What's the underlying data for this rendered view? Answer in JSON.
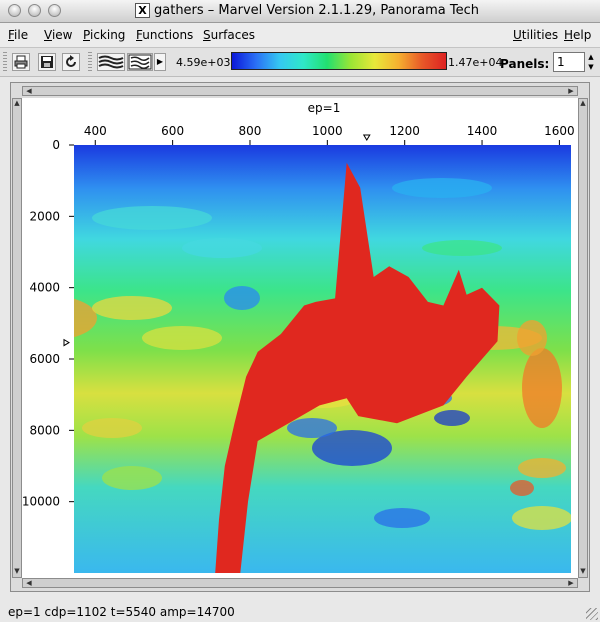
{
  "window": {
    "title": "gathers – Marvel Version 2.1.1.29, Panorama Tech",
    "x_glyph": "X"
  },
  "menu": {
    "file": "File",
    "view": "View",
    "picking": "Picking",
    "functions": "Functions",
    "surfaces": "Surfaces",
    "utilities": "Utilities",
    "help": "Help"
  },
  "toolbar": {
    "colorbar_min": "4.59e+03",
    "colorbar_max": "1.47e+04",
    "panels_label": "Panels:",
    "panels_value": "1",
    "colors": [
      "#0b18d9",
      "#2a6ff5",
      "#35c7f2",
      "#2fe8c8",
      "#22e070",
      "#9be535",
      "#e8e83a",
      "#f5b030",
      "#e85828",
      "#dd2222"
    ]
  },
  "plot": {
    "panel_title": "ep=1",
    "x_ticks": [
      "400",
      "600",
      "800",
      "1000",
      "1200",
      "1400",
      "1600"
    ],
    "y_ticks": [
      "0",
      "2000",
      "4000",
      "6000",
      "8000",
      "10000"
    ]
  },
  "chart_data": {
    "type": "heatmap",
    "title": "ep=1",
    "xlabel": "",
    "ylabel": "",
    "xlim": [
      345,
      1630
    ],
    "ylim": [
      0,
      12000
    ],
    "y_reversed": true,
    "x": [
      400,
      600,
      800,
      1000,
      1200,
      1400,
      1600
    ],
    "y": [
      0,
      2000,
      4000,
      6000,
      8000,
      10000
    ],
    "colorbar_range": [
      4590,
      14700
    ],
    "overlay_body_color": "#e0281f",
    "overlay_body_outline": [
      [
        710,
        12000
      ],
      [
        720,
        10500
      ],
      [
        735,
        9000
      ],
      [
        760,
        7800
      ],
      [
        790,
        6500
      ],
      [
        820,
        5800
      ],
      [
        880,
        5300
      ],
      [
        940,
        4500
      ],
      [
        970,
        4400
      ],
      [
        1020,
        4300
      ],
      [
        1050,
        500
      ],
      [
        1085,
        1200
      ],
      [
        1120,
        3700
      ],
      [
        1160,
        3400
      ],
      [
        1210,
        3700
      ],
      [
        1260,
        4400
      ],
      [
        1300,
        4500
      ],
      [
        1340,
        3500
      ],
      [
        1360,
        4200
      ],
      [
        1400,
        4000
      ],
      [
        1445,
        4500
      ],
      [
        1440,
        5500
      ],
      [
        1360,
        6500
      ],
      [
        1300,
        7300
      ],
      [
        1180,
        7800
      ],
      [
        1080,
        7600
      ],
      [
        1050,
        7100
      ],
      [
        980,
        7300
      ],
      [
        900,
        7800
      ],
      [
        820,
        8300
      ],
      [
        795,
        10000
      ],
      [
        775,
        12000
      ]
    ]
  },
  "status": {
    "text": "ep=1  cdp=1102 t=5540 amp=14700"
  }
}
